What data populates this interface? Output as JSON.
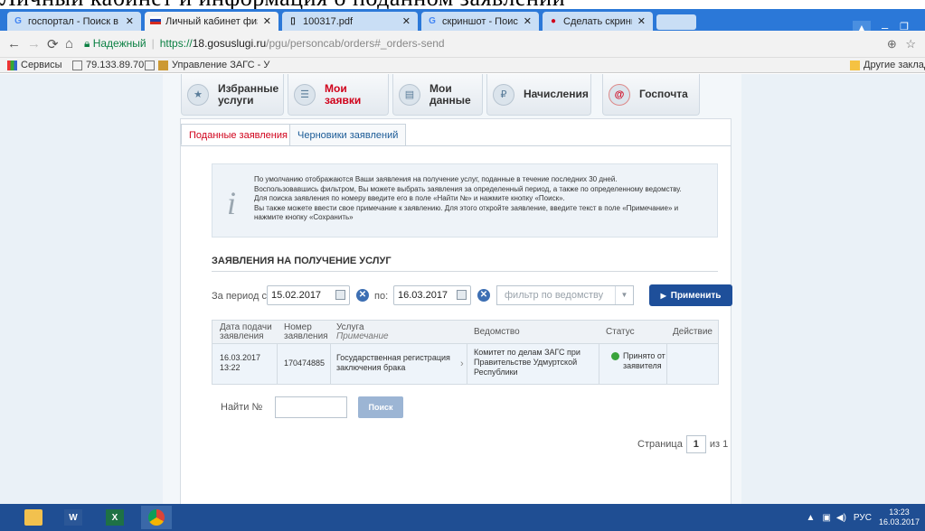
{
  "caption_text": "Личный кабинет и информация о поданном заявлении",
  "browser": {
    "tabs": [
      {
        "label": "госпортал - Поиск в Go",
        "icon": "google-icon"
      },
      {
        "label": "Личный кабинет физич",
        "icon": "russian-flag-icon"
      },
      {
        "label": "100317.pdf",
        "icon": "document-icon"
      },
      {
        "label": "скриншот - Поиск в Goo",
        "icon": "google-icon"
      },
      {
        "label": "Сделать скриншот — O",
        "icon": "page-icon"
      }
    ],
    "address": {
      "secure_label": "Надежный",
      "url_proto": "https://",
      "url_host": "18.gosuslugi.ru",
      "url_path": "/pgu/personcab/orders#_orders-send"
    },
    "bookmarks": [
      {
        "label": "Сервисы"
      },
      {
        "label": "79.133.89.70"
      },
      {
        "label": "Управление ЗАГС - У"
      }
    ],
    "other_bookmarks": "Другие закладки"
  },
  "portal": {
    "nav": [
      {
        "label": "Избранные\nуслуги",
        "icon": "favorites-icon"
      },
      {
        "label": "Мои\nзаявки",
        "icon": "applications-icon"
      },
      {
        "label": "Мои\nданные",
        "icon": "my-data-icon"
      },
      {
        "label": "Начисления",
        "icon": "charges-icon"
      },
      {
        "label": "Госпочта",
        "icon": "mail-icon"
      }
    ],
    "tabs": {
      "submitted": "Поданные заявления",
      "drafts": "Черновики заявлений"
    },
    "info": {
      "line1": "По умолчанию отображаются Ваши заявления на получение услуг, поданные в течение последних 30 дней.",
      "line2": "Воспользовавшись фильтром, Вы можете выбрать заявления за определенный период, а также по определенному ведомству.",
      "line3": "Для поиска заявления по номеру введите его в поле «Найти №» и нажмите кнопку «Поиск».",
      "line4": "Вы также можете ввести свое примечание к заявлению. Для этого откройте заявление, введите текст в поле «Примечание» и",
      "line5": "нажмите кнопку «Сохранить»"
    },
    "section_title": "ЗАЯВЛЕНИЯ НА ПОЛУЧЕНИЕ УСЛУГ",
    "filters": {
      "period_label": "За период с:",
      "date_from": "15.02.2017",
      "to_label": "по:",
      "date_to": "16.03.2017",
      "agency_placeholder": "фильтр по ведомству",
      "apply_label": "Применить"
    },
    "table": {
      "headers": {
        "date": "Дата подачи\nзаявления",
        "number": "Номер\nзаявления",
        "service": "Услуга",
        "note": "Примечание",
        "agency": "Ведомство",
        "status": "Статус",
        "action": "Действие"
      },
      "rows": [
        {
          "date": "16.03.2017\n13:22",
          "number": "170474885",
          "service": "Государственная регистрация\nзаключения брака",
          "agency": "Комитет по делам ЗАГС при\nПравительстве Удмуртской\nРеспублики",
          "status": "Принято от\nзаявителя"
        }
      ]
    },
    "search": {
      "label": "Найти №",
      "value": "",
      "button": "Поиск"
    },
    "pager": {
      "page_label": "Страница",
      "current": "1",
      "of_label": "из 1"
    }
  },
  "taskbar": {
    "apps": [
      "file-explorer-icon",
      "word-icon",
      "excel-icon",
      "chrome-icon"
    ],
    "lang": "РУС",
    "time": "13:23",
    "date": "16.03.2017"
  },
  "colors": {
    "accent_red": "#d0021b",
    "link_blue": "#1a5a96",
    "button_blue": "#1e4f9a",
    "status_green": "#3aa43c",
    "taskbar": "#1f4e93"
  }
}
